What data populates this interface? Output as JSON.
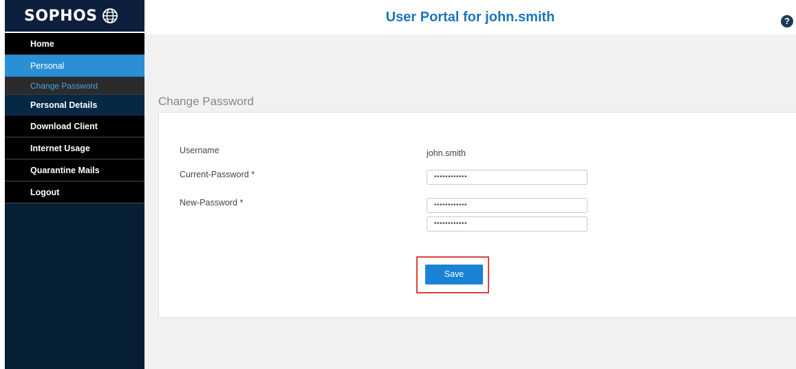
{
  "sidebar": {
    "logo_text": "SOPHOS",
    "items": [
      {
        "label": "Home"
      },
      {
        "label": "Personal"
      },
      {
        "label": "Change Password"
      },
      {
        "label": "Personal Details"
      },
      {
        "label": "Download Client"
      },
      {
        "label": "Internet Usage"
      },
      {
        "label": "Quarantine Mails"
      },
      {
        "label": "Logout"
      }
    ]
  },
  "header": {
    "title": "User Portal for john.smith",
    "help_icon": "help-icon"
  },
  "form": {
    "section_title": "Change Password",
    "username_label": "Username",
    "username_value": "john.smith",
    "current_password_label": "Current-Password *",
    "current_password_value": "••••••••••••",
    "new_password_label": "New-Password *",
    "new_password_value": "••••••••••••",
    "confirm_password_value": "••••••••••••",
    "save_label": "Save"
  },
  "colors": {
    "sidebar_bg": "#061f33",
    "active_item": "#2b8fd6",
    "title_blue": "#1b75bb",
    "save_button": "#1a82d4",
    "highlight": "#e0403a"
  }
}
